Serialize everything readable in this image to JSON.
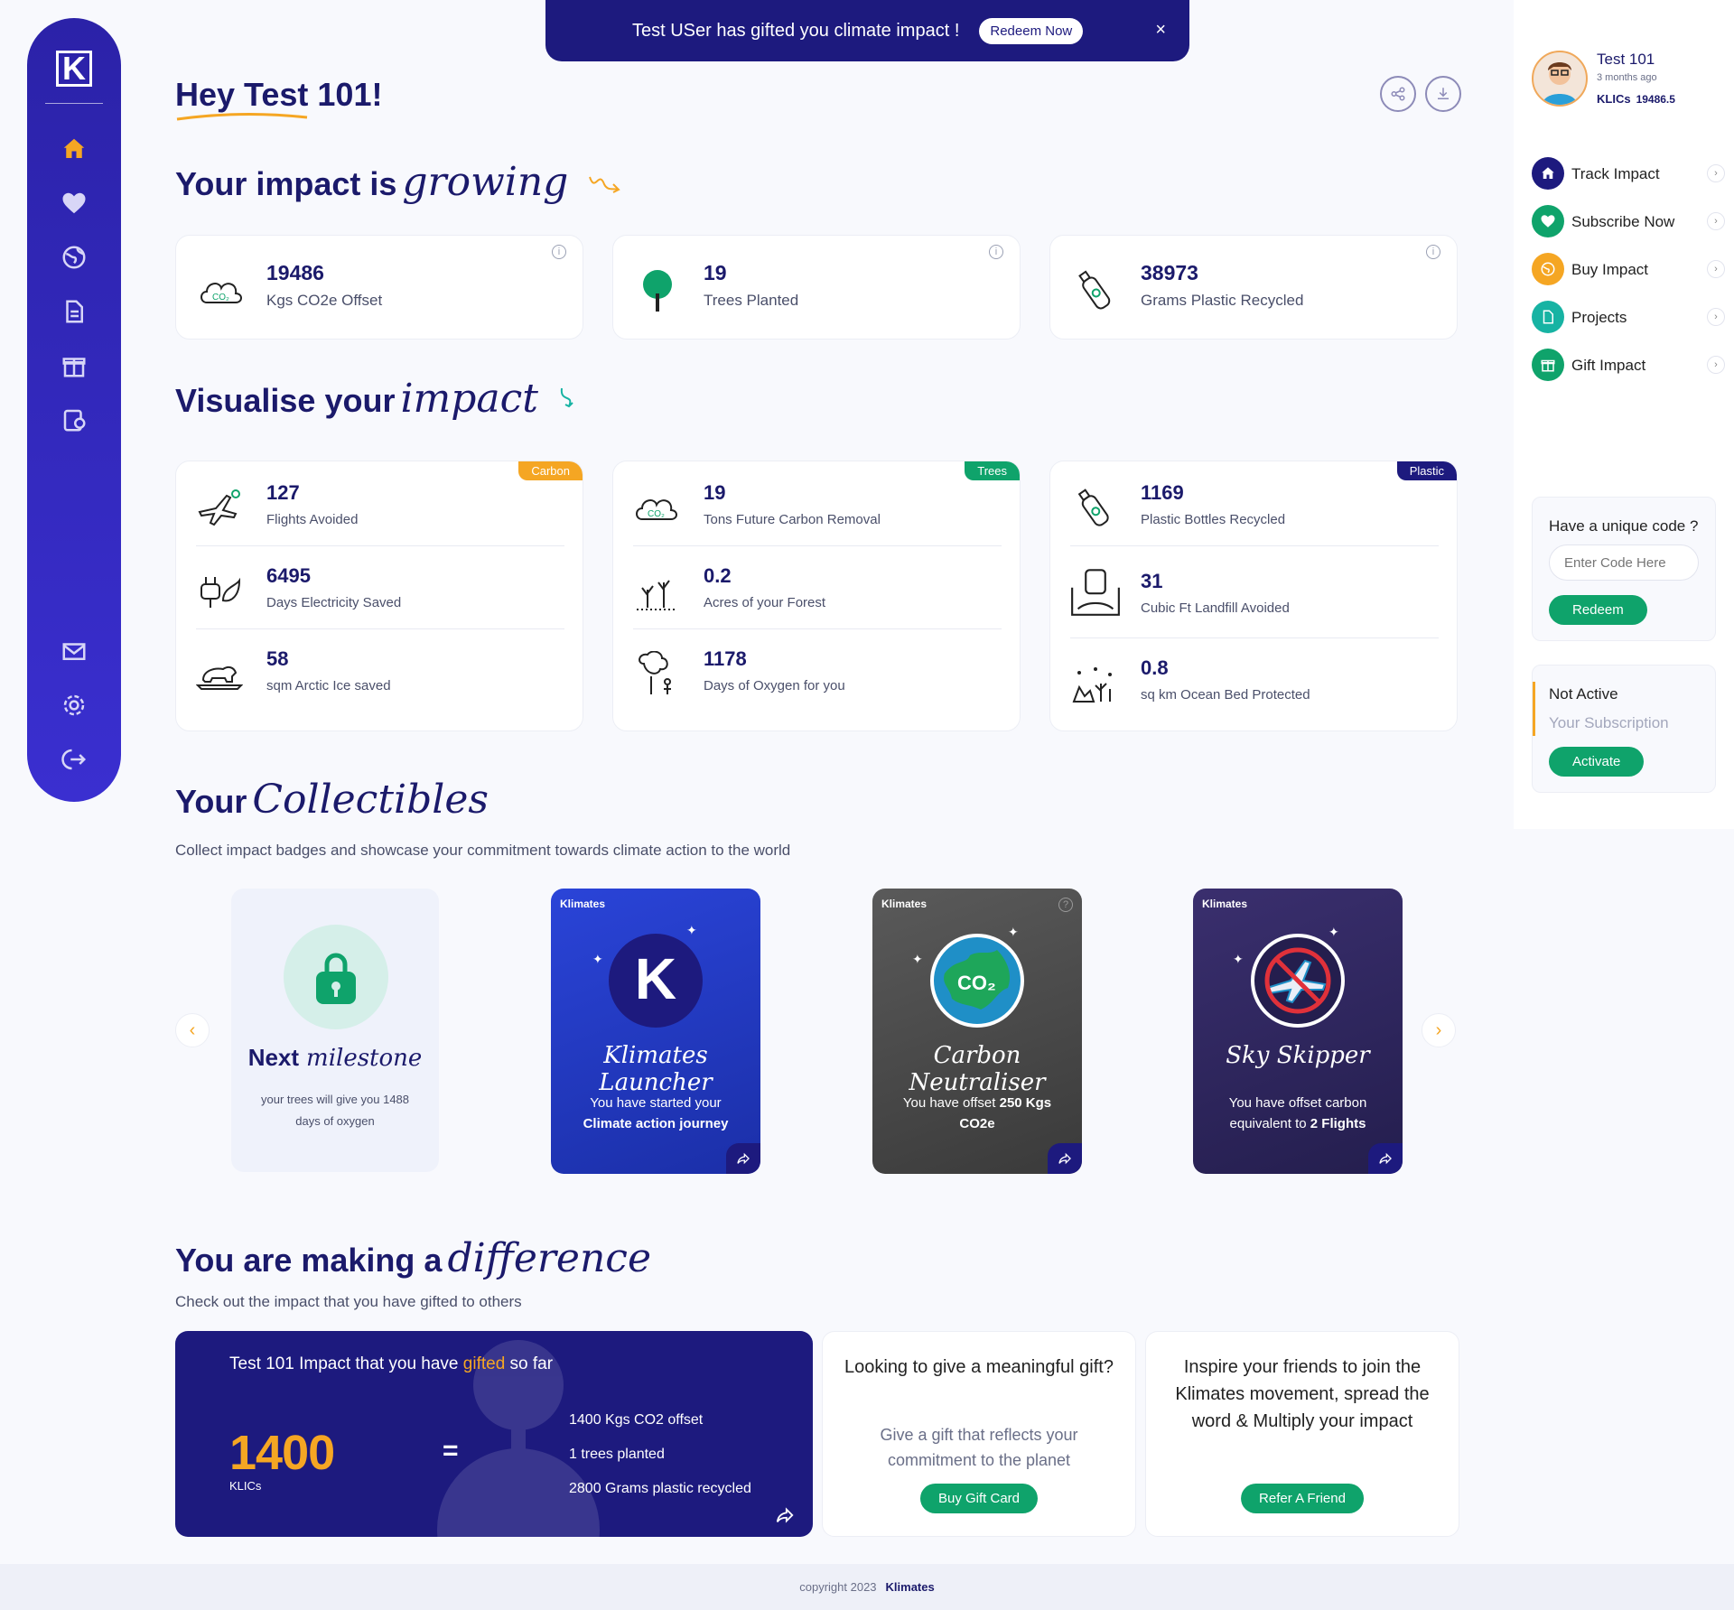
{
  "banner": {
    "text": "Test USer has gifted you climate impact !",
    "button": "Redeem Now",
    "close": "×"
  },
  "greeting": "Hey Test 101!",
  "impact": {
    "title": "Your impact is",
    "title_script": "growing"
  },
  "stats": [
    {
      "value": "19486",
      "label": "Kgs CO2e Offset",
      "icon": "co2-cloud-icon"
    },
    {
      "value": "19",
      "label": "Trees Planted",
      "icon": "tree-icon"
    },
    {
      "value": "38973",
      "label": "Grams Plastic Recycled",
      "icon": "bottle-icon"
    }
  ],
  "visualise": {
    "title": "Visualise your",
    "title_script": "impact",
    "cards": [
      {
        "tag": "Carbon",
        "tag_color": "#f5a623",
        "rows": [
          {
            "value": "127",
            "label": "Flights Avoided"
          },
          {
            "value": "6495",
            "label": "Days Electricity Saved"
          },
          {
            "value": "58",
            "label": "sqm Arctic Ice saved"
          }
        ]
      },
      {
        "tag": "Trees",
        "tag_color": "#0fa36b",
        "rows": [
          {
            "value": "19",
            "label": "Tons Future Carbon Removal"
          },
          {
            "value": "0.2",
            "label": "Acres of your Forest"
          },
          {
            "value": "1178",
            "label": "Days of Oxygen for you"
          }
        ]
      },
      {
        "tag": "Plastic",
        "tag_color": "#1d1a7e",
        "rows": [
          {
            "value": "1169",
            "label": "Plastic Bottles Recycled"
          },
          {
            "value": "31",
            "label": "Cubic Ft Landfill Avoided"
          },
          {
            "value": "0.8",
            "label": "sq km Ocean Bed Protected"
          }
        ]
      }
    ]
  },
  "collectibles": {
    "title": "Your",
    "title_script": "Collectibles",
    "subtitle": "Collect impact badges and showcase your commitment towards climate action to the world",
    "milestone": {
      "title": "Next",
      "title_script": "milestone",
      "text": "your trees will give you 1488 days of oxygen"
    },
    "badges": [
      {
        "brand": "Klimates",
        "title": "Klimates Launcher",
        "desc_pre": "You have started your",
        "desc_bold": "Climate action journey"
      },
      {
        "brand": "Klimates",
        "title": "Carbon Neutraliser",
        "desc_pre": "You have offset",
        "desc_bold": "250 Kgs CO2e"
      },
      {
        "brand": "Klimates",
        "title": "Sky Skipper",
        "desc_pre": "You have offset carbon equivalent to",
        "desc_bold": "2 Flights"
      }
    ],
    "prev": "‹",
    "next": "›"
  },
  "difference": {
    "title": "You are making a",
    "title_script": "difference",
    "subtitle": "Check out the impact that you have gifted to others",
    "gift": {
      "head_pre": "Test 101 Impact that you have",
      "head_hl": "gifted",
      "head_post": "so far",
      "value": "1400",
      "unit": "KLICs",
      "eq": "=",
      "items": [
        "1400 Kgs CO2 offset",
        "1 trees planted",
        "2800 Grams plastic recycled"
      ]
    },
    "gift_card": {
      "title": "Looking to give a meaningful gift?",
      "sub": "Give a gift that reflects your commitment to the planet",
      "button": "Buy Gift Card"
    },
    "refer_card": {
      "title": "Inspire your friends to join the Klimates movement, spread the word & Multiply your impact",
      "button": "Refer A Friend"
    }
  },
  "user": {
    "name": "Test 101",
    "time": "3 months ago",
    "klics_label": "KLICs",
    "klics_value": "19486.5"
  },
  "nav": [
    {
      "label": "Track Impact",
      "color": "#1d1a7e",
      "icon": "home-icon"
    },
    {
      "label": "Subscribe Now",
      "color": "#0fa36b",
      "icon": "heart-icon"
    },
    {
      "label": "Buy Impact",
      "color": "#f5a623",
      "icon": "globe-icon"
    },
    {
      "label": "Projects",
      "color": "#17b3a3",
      "icon": "document-icon"
    },
    {
      "label": "Gift Impact",
      "color": "#0fa36b",
      "icon": "gift-icon"
    }
  ],
  "code": {
    "title": "Have a unique code ?",
    "placeholder": "Enter Code Here",
    "button": "Redeem"
  },
  "subscription": {
    "status": "Not Active",
    "label": "Your Subscription",
    "button": "Activate"
  },
  "footer": {
    "text": "copyright 2023",
    "brand": "Klimates"
  },
  "sidebar_logo": "K"
}
